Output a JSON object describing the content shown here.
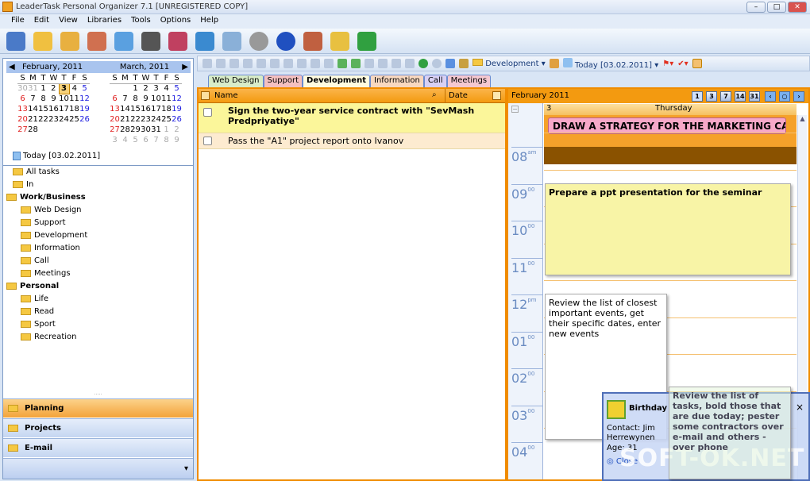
{
  "window": {
    "title": "LeaderTask Personal Organizer 7.1 [UNREGISTERED COPY]",
    "min": "–",
    "max": "□",
    "close": "✕"
  },
  "menu": [
    "File",
    "Edit",
    "View",
    "Libraries",
    "Tools",
    "Options",
    "Help"
  ],
  "calendar": {
    "feb": {
      "title": "February, 2011",
      "dow": [
        "S",
        "M",
        "T",
        "W",
        "T",
        "F",
        "S"
      ],
      "weeks": [
        [
          "30",
          "31",
          "1",
          "2",
          "3",
          "4",
          "5"
        ],
        [
          "6",
          "7",
          "8",
          "9",
          "10",
          "11",
          "12"
        ],
        [
          "13",
          "14",
          "15",
          "16",
          "17",
          "18",
          "19"
        ],
        [
          "20",
          "21",
          "22",
          "23",
          "24",
          "25",
          "26"
        ],
        [
          "27",
          "28",
          "",
          "",
          "",
          "",
          ""
        ]
      ]
    },
    "mar": {
      "title": "March, 2011",
      "dow": [
        "S",
        "M",
        "T",
        "W",
        "T",
        "F",
        "S"
      ],
      "weeks": [
        [
          "",
          "",
          "1",
          "2",
          "3",
          "4",
          "5"
        ],
        [
          "6",
          "7",
          "8",
          "9",
          "10",
          "11",
          "12"
        ],
        [
          "13",
          "14",
          "15",
          "16",
          "17",
          "18",
          "19"
        ],
        [
          "20",
          "21",
          "22",
          "23",
          "24",
          "25",
          "26"
        ],
        [
          "27",
          "28",
          "29",
          "30",
          "31",
          "1",
          "2"
        ],
        [
          "3",
          "4",
          "5",
          "6",
          "7",
          "8",
          "9"
        ]
      ]
    },
    "today": "Today [03.02.2011]"
  },
  "tree": {
    "all": "All tasks",
    "in": "In",
    "work": "Work/Business",
    "work_items": [
      "Web Design",
      "Support",
      "Development",
      "Information",
      "Call",
      "Meetings"
    ],
    "personal": "Personal",
    "personal_items": [
      "Life",
      "Read",
      "Sport",
      "Recreation"
    ]
  },
  "nav": {
    "planning": "Planning",
    "projects": "Projects",
    "email": "E-mail"
  },
  "toolbar2": {
    "category": "Development",
    "today": "Today [03.02.2011]"
  },
  "tabs": [
    {
      "label": "Web Design",
      "color": "#d8ecc8"
    },
    {
      "label": "Support",
      "color": "#f4c0c0"
    },
    {
      "label": "Development",
      "color": "#fffbe0"
    },
    {
      "label": "Information",
      "color": "#f8d8c0"
    },
    {
      "label": "Call",
      "color": "#d8d0f4"
    },
    {
      "label": "Meetings",
      "color": "#f4c8d0"
    }
  ],
  "tasklist": {
    "col_name": "Name",
    "col_date": "Date",
    "rows": [
      {
        "text": "Sign the two-year service contract with \"SevMash Predpriyatiye\"",
        "bold": true
      },
      {
        "text": "Pass the \"A1\" project report onto Ivanov",
        "bold": false
      }
    ]
  },
  "planner": {
    "month": "February 2011",
    "views": [
      "1",
      "3",
      "7",
      "14",
      "31"
    ],
    "day_num": "3",
    "day_name": "Thursday",
    "hours": [
      {
        "h": "08",
        "s": "am"
      },
      {
        "h": "09",
        "s": "00"
      },
      {
        "h": "10",
        "s": "00"
      },
      {
        "h": "11",
        "s": "00"
      },
      {
        "h": "12",
        "s": "pm"
      },
      {
        "h": "01",
        "s": "00"
      },
      {
        "h": "02",
        "s": "00"
      },
      {
        "h": "03",
        "s": "00"
      },
      {
        "h": "04",
        "s": "00"
      }
    ],
    "allday": "DRAW A STRATEGY FOR THE MARKETING CAMPAI",
    "events": [
      "Prepare a ppt presentation for the seminar",
      "Review the list of closest important events, get their specific dates, enter new events",
      "Review the list of tasks, bold those that are due today; pester some contractors over e-mail and others - over phone"
    ]
  },
  "popup": {
    "title": "Birthday",
    "contact": "Contact: Jim Herrewynen",
    "age": "Age: 31",
    "close": "×",
    "action": "Close"
  },
  "watermark": "SOFT-OK.NET"
}
